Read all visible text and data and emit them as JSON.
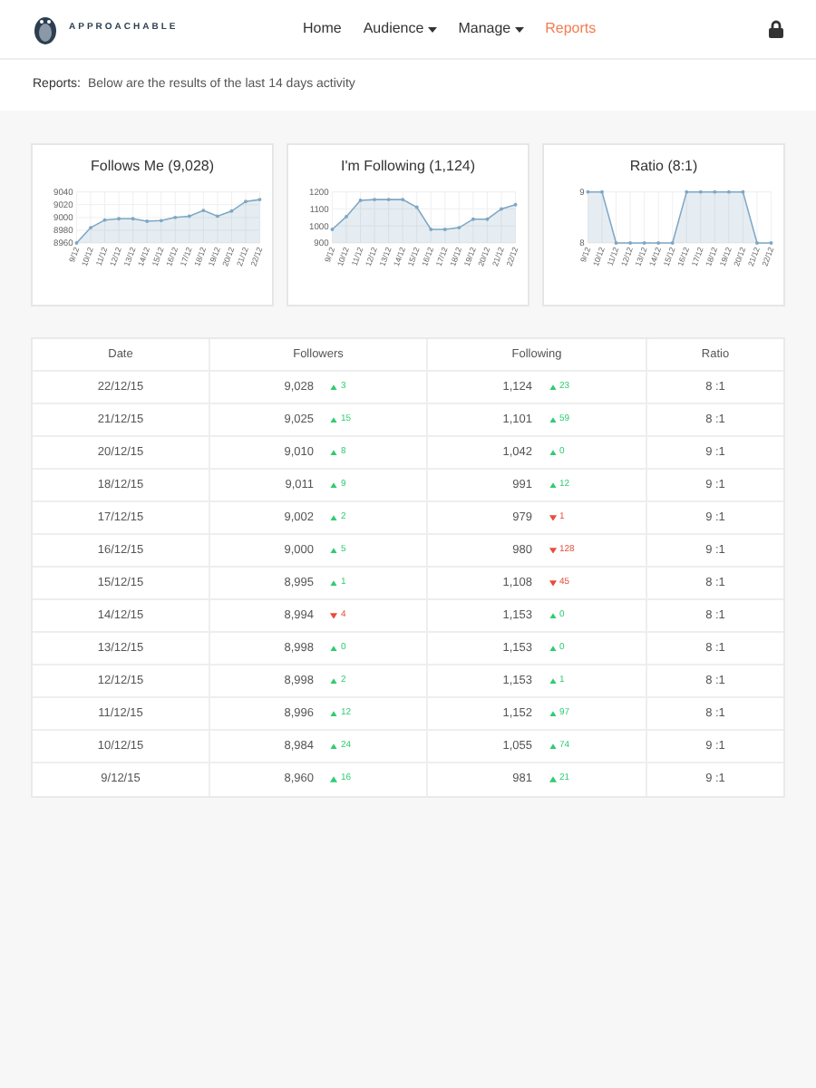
{
  "header": {
    "logo_text": "APPROACHABLE",
    "nav": [
      {
        "label": "Home",
        "selected": false,
        "dropdown": false
      },
      {
        "label": "Audience",
        "selected": false,
        "dropdown": true
      },
      {
        "label": "Manage",
        "selected": false,
        "dropdown": true
      },
      {
        "label": "Reports",
        "selected": true,
        "dropdown": false
      }
    ]
  },
  "subheader": {
    "label": "Reports:",
    "text": "Below are the results of the last 14 days activity"
  },
  "charts": [
    {
      "title": "Follows Me (9,028)",
      "chart_data": {
        "type": "area",
        "grid": true,
        "categories": [
          "9/12",
          "10/12",
          "11/12",
          "12/12",
          "13/12",
          "14/12",
          "15/12",
          "16/12",
          "17/12",
          "18/12",
          "19/12",
          "20/12",
          "21/12",
          "22/12"
        ],
        "ylim": [
          8960,
          9040
        ],
        "yticks": [
          8960,
          8980,
          9000,
          9020,
          9040
        ],
        "series": [
          {
            "color": "#7ea7c4",
            "values": [
              8960,
              8984,
              8996,
              8998,
              8998,
              8994,
              8995,
              9000,
              9002,
              9011,
              9002,
              9010,
              9025,
              9028
            ]
          }
        ]
      }
    },
    {
      "title": "I'm Following (1,124)",
      "chart_data": {
        "type": "area",
        "grid": true,
        "categories": [
          "9/12",
          "10/12",
          "11/12",
          "12/12",
          "13/12",
          "14/12",
          "15/12",
          "16/12",
          "17/12",
          "18/12",
          "19/12",
          "20/12",
          "21/12",
          "22/12"
        ],
        "ylim": [
          900,
          1200
        ],
        "yticks": [
          900,
          1000,
          1100,
          1200
        ],
        "series": [
          {
            "color": "#7ea7c4",
            "values": [
              980,
              1055,
              1150,
              1155,
              1155,
              1155,
              1110,
              980,
              980,
              990,
              1040,
              1040,
              1100,
              1125
            ]
          }
        ]
      }
    },
    {
      "title": "Ratio (8:1)",
      "chart_data": {
        "type": "area",
        "grid": true,
        "categories": [
          "9/12",
          "10/12",
          "11/12",
          "12/12",
          "13/12",
          "14/12",
          "15/12",
          "16/12",
          "17/12",
          "18/12",
          "19/12",
          "20/12",
          "21/12",
          "22/12"
        ],
        "ylim": [
          8,
          9
        ],
        "yticks": [
          8,
          9
        ],
        "series": [
          {
            "color": "#7ea7c4",
            "values": [
              9,
              9,
              8,
              8,
              8,
              8,
              8,
              9,
              9,
              9,
              9,
              9,
              8,
              8
            ]
          }
        ]
      }
    }
  ],
  "table": {
    "columns": [
      "Date",
      "Followers",
      "Following",
      "Ratio"
    ],
    "rows": [
      {
        "date": "22/12/15",
        "followers": "9,028",
        "followers_change": {
          "kind": "up",
          "text": "3"
        },
        "following": "1,124",
        "following_change": {
          "kind": "up",
          "text": "23"
        },
        "ratio": "8 :1"
      },
      {
        "date": "21/12/15",
        "followers": "9,025",
        "followers_change": {
          "kind": "up",
          "text": "15"
        },
        "following": "1,101",
        "following_change": {
          "kind": "up",
          "text": "59"
        },
        "ratio": "8 :1"
      },
      {
        "date": "20/12/15",
        "followers": "9,010",
        "followers_change": {
          "kind": "up",
          "text": "8"
        },
        "following": "1,042",
        "following_change": {
          "kind": "up",
          "text": "0"
        },
        "ratio": "9 :1"
      },
      {
        "date": "18/12/15",
        "followers": "9,011",
        "followers_change": {
          "kind": "up",
          "text": "9"
        },
        "following": "991",
        "following_change": {
          "kind": "up",
          "text": "12"
        },
        "ratio": "9 :1"
      },
      {
        "date": "17/12/15",
        "followers": "9,002",
        "followers_change": {
          "kind": "up",
          "text": "2"
        },
        "following": "979",
        "following_change": {
          "kind": "down",
          "text": "1"
        },
        "ratio": "9 :1"
      },
      {
        "date": "16/12/15",
        "followers": "9,000",
        "followers_change": {
          "kind": "up",
          "text": "5"
        },
        "following": "980",
        "following_change": {
          "kind": "down",
          "text": "128"
        },
        "ratio": "9 :1"
      },
      {
        "date": "15/12/15",
        "followers": "8,995",
        "followers_change": {
          "kind": "up",
          "text": "1"
        },
        "following": "1,108",
        "following_change": {
          "kind": "down",
          "text": "45"
        },
        "ratio": "8 :1"
      },
      {
        "date": "14/12/15",
        "followers": "8,994",
        "followers_change": {
          "kind": "down",
          "text": "4"
        },
        "following": "1,153",
        "following_change": {
          "kind": "up",
          "text": "0"
        },
        "ratio": "8 :1"
      },
      {
        "date": "13/12/15",
        "followers": "8,998",
        "followers_change": {
          "kind": "up",
          "text": "0"
        },
        "following": "1,153",
        "following_change": {
          "kind": "up",
          "text": "0"
        },
        "ratio": "8 :1"
      },
      {
        "date": "12/12/15",
        "followers": "8,998",
        "followers_change": {
          "kind": "up",
          "text": "2"
        },
        "following": "1,153",
        "following_change": {
          "kind": "up",
          "text": "1"
        },
        "ratio": "8 :1"
      },
      {
        "date": "11/12/15",
        "followers": "8,996",
        "followers_change": {
          "kind": "up",
          "text": "12"
        },
        "following": "1,152",
        "following_change": {
          "kind": "up",
          "text": "97"
        },
        "ratio": "8 :1"
      },
      {
        "date": "10/12/15",
        "followers": "8,984",
        "followers_change": {
          "kind": "up",
          "text": "24"
        },
        "following": "1,055",
        "following_change": {
          "kind": "up",
          "text": "74"
        },
        "ratio": "9 :1"
      },
      {
        "date": "9/12/15",
        "followers": "8,960",
        "followers_change": {
          "kind": "up",
          "text": "16"
        },
        "following": "981",
        "following_change": {
          "kind": "up",
          "text": "21"
        },
        "ratio": "9 :1"
      }
    ]
  }
}
